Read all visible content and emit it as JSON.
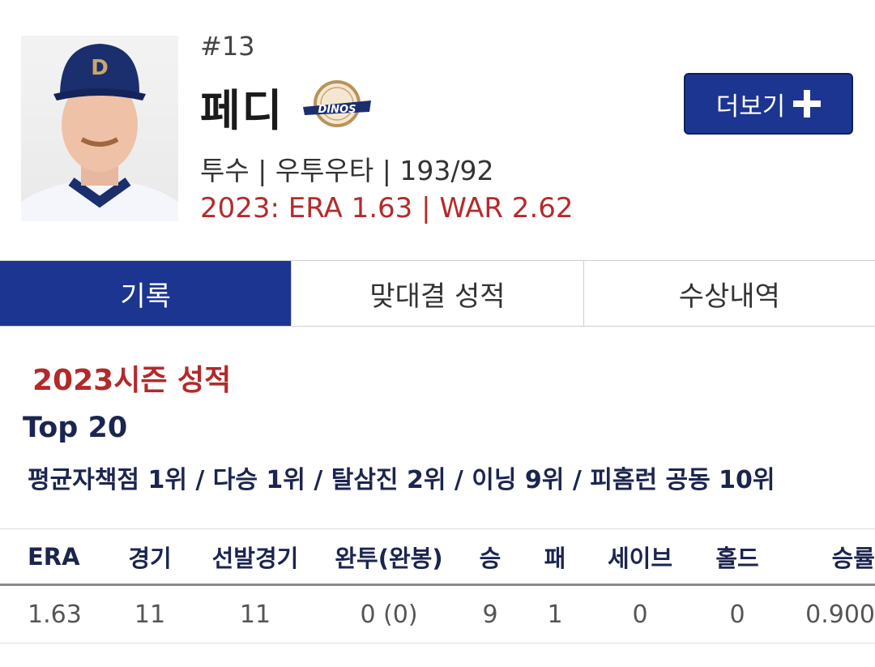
{
  "player": {
    "number": "#13",
    "name": "페디",
    "team_logo_text": "NC Dinos",
    "meta": "투수 | 우투우타 | 193/92",
    "season_stats_line": "2023: ERA 1.63 | WAR 2.62"
  },
  "more_button": {
    "label": "더보기",
    "icon": "plus-icon"
  },
  "tabs": [
    {
      "label": "기록",
      "active": true
    },
    {
      "label": "맞대결 성적",
      "active": false
    },
    {
      "label": "수상내역",
      "active": false
    }
  ],
  "season": {
    "title": "2023시즌 성적",
    "top20_title": "Top 20",
    "top20_detail": "평균자책점 1위 / 다승 1위 / 탈삼진 2위 / 이닝 9위 / 피홈런 공동 10위"
  },
  "table": {
    "headers": [
      "ERA",
      "경기",
      "선발경기",
      "완투(완봉)",
      "승",
      "패",
      "세이브",
      "홀드",
      "승률"
    ],
    "values": [
      "1.63",
      "11",
      "11",
      "0 (0)",
      "9",
      "1",
      "0",
      "0",
      "0.900"
    ]
  },
  "colors": {
    "accent_navy": "#1b3590",
    "highlight_red": "#b52b2b",
    "text_navy": "#1c2550"
  }
}
